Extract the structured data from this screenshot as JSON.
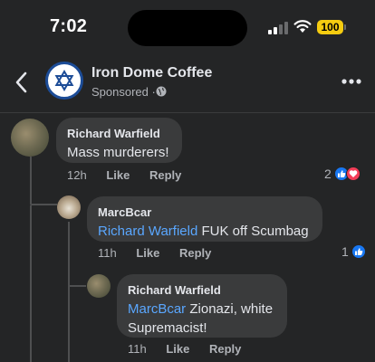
{
  "status_bar": {
    "time": "7:02",
    "battery": "100"
  },
  "post_header": {
    "page_name": "Iron Dome Coffee",
    "sponsored": "Sponsored ·"
  },
  "comments": [
    {
      "author": "Richard Warfield",
      "text": "Mass murderers!",
      "time": "12h",
      "like": "Like",
      "reply": "Reply",
      "reaction_count": "2"
    },
    {
      "author": "MarcBcar",
      "mention": "Richard Warfield",
      "text": " FUK off Scumbag",
      "time": "11h",
      "like": "Like",
      "reply": "Reply",
      "reaction_count": "1"
    },
    {
      "author": "Richard Warfield",
      "mention": "MarcBcar",
      "text_line1": " Zionazi, white",
      "text_line2": "Supremacist!",
      "time": "11h",
      "like": "Like",
      "reply": "Reply"
    }
  ],
  "colors": {
    "background": "#242526",
    "bubble": "#3a3b3c",
    "mention": "#5aa7ff",
    "like_reaction": "#1877f2",
    "love_reaction": "#f33e58",
    "battery": "#f5cc10",
    "brand_blue": "#1c4c97"
  },
  "icons": [
    "back-chevron-icon",
    "star-of-david-logo-icon",
    "globe-icon",
    "more-icon",
    "like-reaction-icon",
    "love-reaction-icon",
    "signal-icon",
    "wifi-icon",
    "battery-icon"
  ]
}
